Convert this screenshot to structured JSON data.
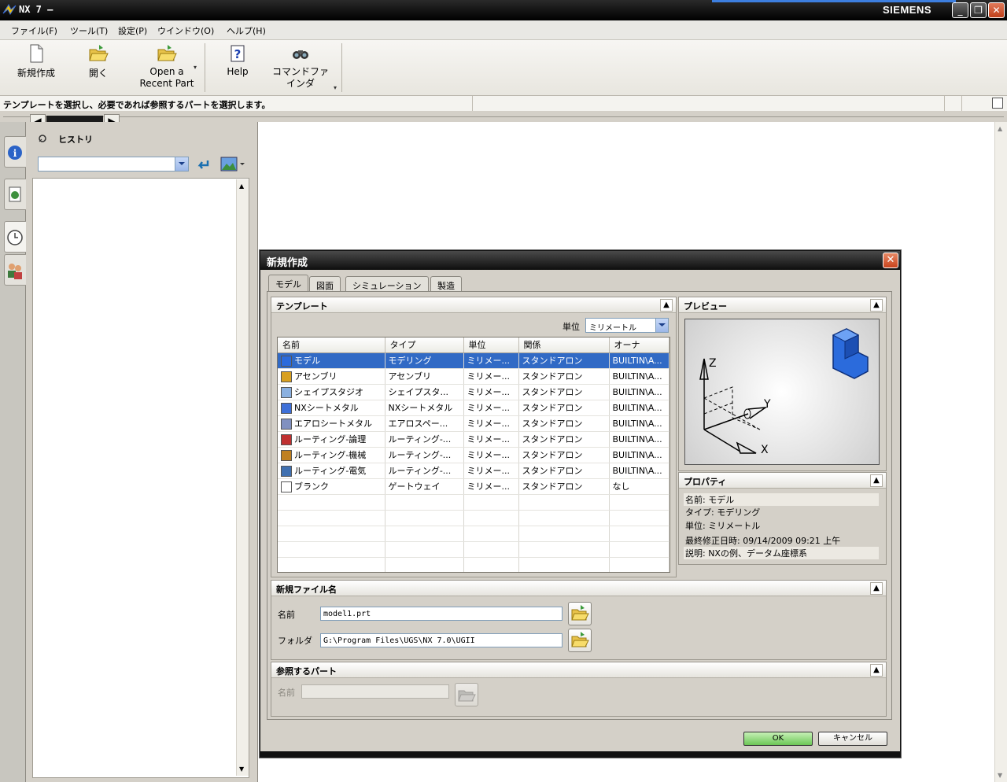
{
  "window": {
    "title": "NX 7 –",
    "brand": "SIEMENS",
    "minimize_glyph": "_",
    "restore_glyph": "❐",
    "close_glyph": "✕"
  },
  "menu": [
    "ファイル(F)",
    "ツール(T)",
    "設定(P)",
    "ウインドウ(O)",
    "ヘルプ(H)"
  ],
  "toolbar": {
    "new_label": "新規作成",
    "open_label": "開く",
    "recent_label_1": "Open a",
    "recent_label_2": "Recent Part",
    "help_label": "Help",
    "cmdfind_label_1": "コマンドファ",
    "cmdfind_label_2": "インダ",
    "dropdown_glyph": "▾"
  },
  "status": {
    "message": "テンプレートを選択し、必要であれば参照するパートを選択します。"
  },
  "navigator": {
    "title": "ヒストリ",
    "left_arrow": "◀",
    "right_arrow": "▶",
    "combo_value": ""
  },
  "dialog": {
    "title": "新規作成",
    "close_glyph": "✕",
    "tabs": [
      "モデル",
      "図面",
      "シミュレーション",
      "製造"
    ],
    "templates": {
      "section_title": "テンプレート",
      "units_label": "単位",
      "units_value": "ミリメートル",
      "columns": [
        "名前",
        "タイプ",
        "単位",
        "関係",
        "オーナ"
      ],
      "rows": [
        [
          "モデル",
          "モデリング",
          "ミリメー...",
          "スタンドアロン",
          "BUILTIN\\A..."
        ],
        [
          "アセンブリ",
          "アセンブリ",
          "ミリメー...",
          "スタンドアロン",
          "BUILTIN\\A..."
        ],
        [
          "シェイプスタジオ",
          "シェイプスタ...",
          "ミリメー...",
          "スタンドアロン",
          "BUILTIN\\A..."
        ],
        [
          "NXシートメタル",
          "NXシートメタル",
          "ミリメー...",
          "スタンドアロン",
          "BUILTIN\\A..."
        ],
        [
          "エアロシートメタル",
          "エアロスペー...",
          "ミリメー...",
          "スタンドアロン",
          "BUILTIN\\A..."
        ],
        [
          "ルーティング-論理",
          "ルーティング-...",
          "ミリメー...",
          "スタンドアロン",
          "BUILTIN\\A..."
        ],
        [
          "ルーティング-機械",
          "ルーティング-...",
          "ミリメー...",
          "スタンドアロン",
          "BUILTIN\\A..."
        ],
        [
          "ルーティング-電気",
          "ルーティング-...",
          "ミリメー...",
          "スタンドアロン",
          "BUILTIN\\A..."
        ],
        [
          "ブランク",
          "ゲートウェイ",
          "ミリメー...",
          "スタンドアロン",
          "なし"
        ]
      ],
      "empty_rows": 5
    },
    "preview": {
      "section_title": "プレビュー",
      "axis_x": "X",
      "axis_y": "Y",
      "axis_z": "Z"
    },
    "properties": {
      "section_title": "プロパティ",
      "lines": [
        "名前: モデル",
        "タイプ: モデリング",
        "単位: ミリメートル",
        "最終修正日時: 09/14/2009 09:21 上午",
        "説明: NXの例、データム座標系"
      ]
    },
    "new_file": {
      "section_title": "新規ファイル名",
      "name_label": "名前",
      "name_value": "model1.prt",
      "folder_label": "フォルダ",
      "folder_value": "G:\\Program Files\\UGS\\NX 7.0\\UGII"
    },
    "ref_part": {
      "section_title": "参照するパート",
      "name_label": "名前",
      "name_value": ""
    },
    "ok_label": "OK",
    "cancel_label": "キャンセル"
  },
  "colors": {
    "selection": "#316ac5",
    "title_bar": "#000000",
    "ok_button": "#7fd36a",
    "close_button": "#c8431d"
  }
}
